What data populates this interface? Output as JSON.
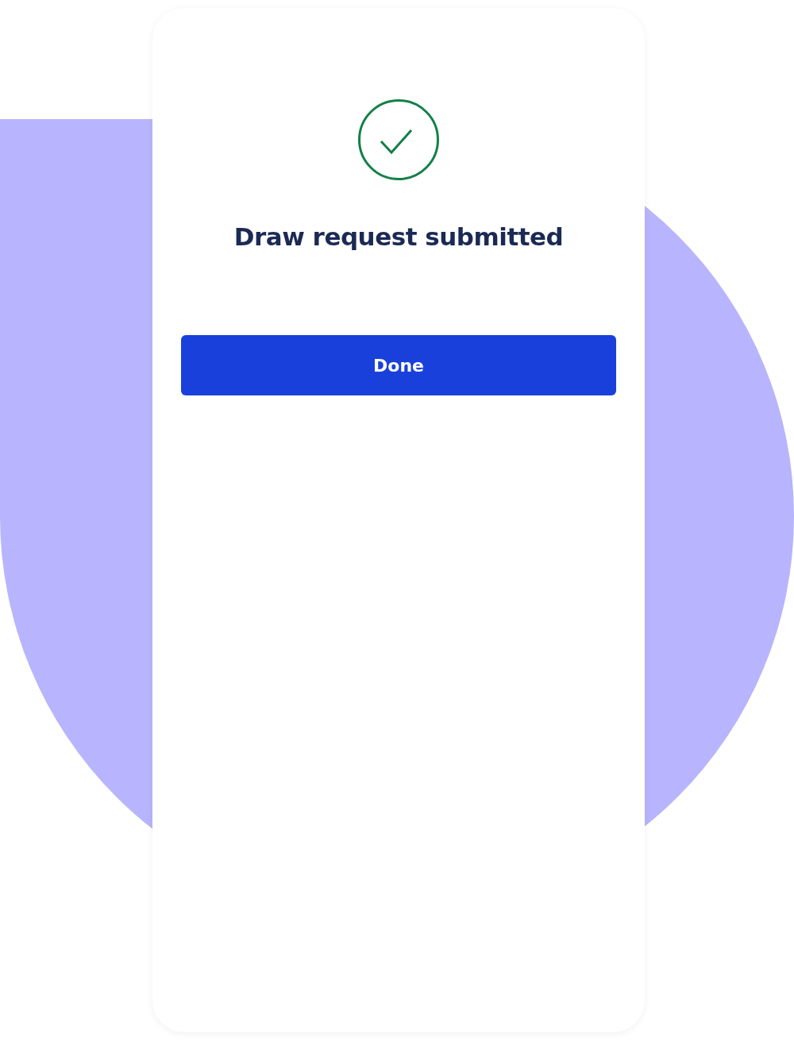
{
  "title": "Draw request submitted",
  "button": {
    "label": "Done"
  }
}
